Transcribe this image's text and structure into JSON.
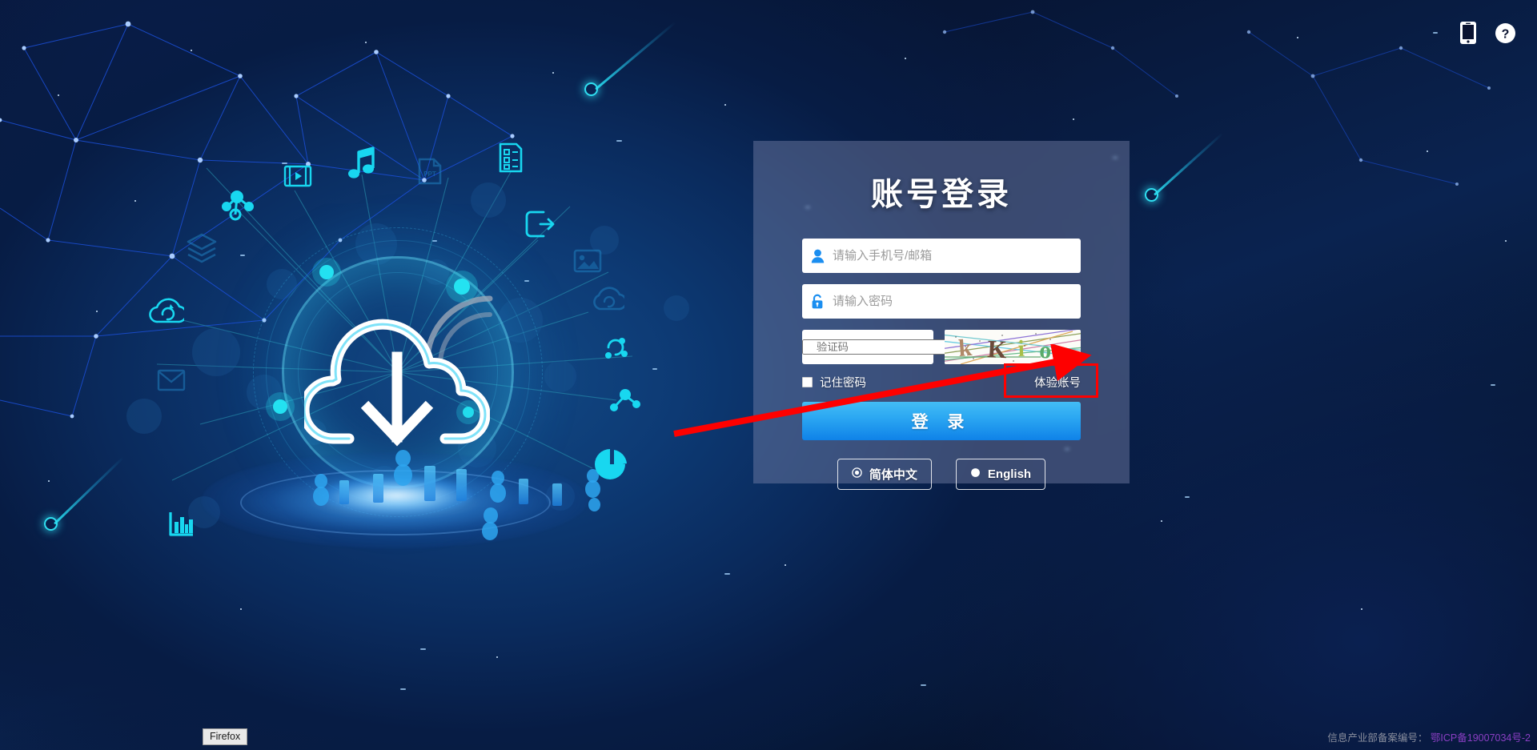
{
  "page": {
    "title": "账号登录"
  },
  "topbar": {
    "mobile_icon": "mobile-phone-icon",
    "help_icon": "question-mark-help-icon"
  },
  "login": {
    "heading": "账号登录",
    "username": {
      "placeholder": "请输入手机号/邮箱",
      "value": "",
      "icon": "user-icon"
    },
    "password": {
      "placeholder": "请输入密码",
      "value": "",
      "icon": "lock-icon"
    },
    "captcha": {
      "placeholder": "验证码",
      "value": "",
      "image_text": "kKio",
      "chars": [
        {
          "ch": "k",
          "color": "#b08968"
        },
        {
          "ch": "K",
          "color": "#6b4a3a"
        },
        {
          "ch": "i",
          "color": "#a8bf4a"
        },
        {
          "ch": "o",
          "color": "#5aab6a"
        }
      ]
    },
    "remember_label": "记住密码",
    "remember_checked": false,
    "trial_account_label": "体验账号",
    "submit_label": "登 录",
    "languages": [
      {
        "label": "简体中文",
        "selected": true,
        "icon": "radio-selected-icon"
      },
      {
        "label": "English",
        "selected": false,
        "icon": "radio-filled-icon"
      }
    ]
  },
  "annotation": {
    "arrow_color": "#fe0000",
    "highlight_color": "#fe0000",
    "target": "体验账号"
  },
  "footer": {
    "label": "信息产业部备案编号：",
    "icp": "鄂ICP备19007034号-2"
  },
  "taskbar": {
    "app_label": "Firefox"
  },
  "illustration": {
    "center_icon": "cloud-download-icon",
    "satellite_icons": [
      "film-video-icon",
      "music-note-icon",
      "ppt-document-icon",
      "list-document-icon",
      "exit-arrow-icon",
      "image-picture-icon",
      "layers-stack-icon",
      "share-node-icon",
      "cloud-sync-icon",
      "envelope-mail-icon",
      "bar-chart-icon",
      "pie-chart-icon",
      "node-graph-icon"
    ]
  },
  "colors": {
    "accent": "#2ba7f2",
    "panel": "rgba(128,138,176,0.42)",
    "icon_cyan": "#18d7f0",
    "highlight_red": "#fe0000",
    "icp_link": "#8b3fc4"
  }
}
